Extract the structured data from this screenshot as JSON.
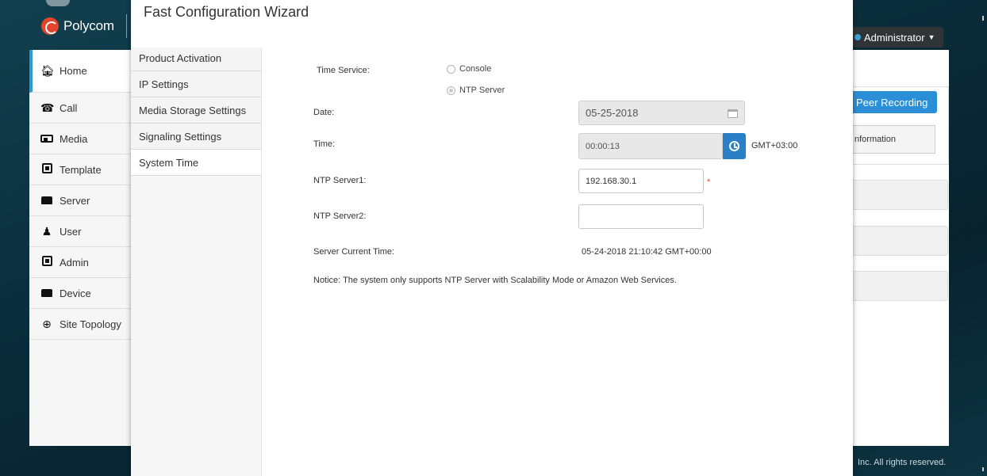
{
  "app": {
    "brand": "Polycom",
    "admin_label": "Administrator",
    "peer_recording_label": "Peer Recording",
    "information_label": "nformation",
    "footer": "Inc. All rights reserved."
  },
  "nav": {
    "items": [
      {
        "label": "Home",
        "icon": "home-icon"
      },
      {
        "label": "Call",
        "icon": "phone-icon"
      },
      {
        "label": "Media",
        "icon": "media-icon"
      },
      {
        "label": "Template",
        "icon": "template-icon"
      },
      {
        "label": "Server",
        "icon": "server-icon"
      },
      {
        "label": "User",
        "icon": "user-icon"
      },
      {
        "label": "Admin",
        "icon": "admin-icon"
      },
      {
        "label": "Device",
        "icon": "device-icon"
      },
      {
        "label": "Site Topology",
        "icon": "globe-icon"
      }
    ]
  },
  "wizard": {
    "title": "Fast Configuration Wizard",
    "steps": [
      {
        "label": "Product Activation"
      },
      {
        "label": "IP Settings"
      },
      {
        "label": "Media Storage Settings"
      },
      {
        "label": "Signaling Settings"
      },
      {
        "label": "System Time",
        "active": true
      }
    ]
  },
  "form": {
    "time_service_label": "Time Service:",
    "option_console": "Console",
    "option_ntp": "NTP Server",
    "selected_option": "NTP Server",
    "date_label": "Date:",
    "date_value": "05-25-2018",
    "time_label": "Time:",
    "time_value": "00:00:13",
    "timezone": "GMT+03:00",
    "ntp1_label": "NTP Server1:",
    "ntp1_value": "192.168.30.1",
    "required_mark": "*",
    "ntp2_label": "NTP Server2:",
    "ntp2_value": "",
    "server_time_label": "Server Current Time:",
    "server_time_value": "05-24-2018 21:10:42 GMT+00:00",
    "notice": "Notice: The system only supports NTP Server with Scalability Mode or Amazon Web Services."
  },
  "colors": {
    "accent": "#2a7fc6",
    "nav_active": "#2a9bd6",
    "required": "#e0443a",
    "background": "#0b2f3d"
  }
}
